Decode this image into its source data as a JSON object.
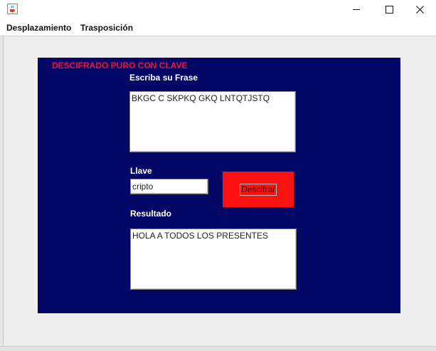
{
  "window": {
    "icon": "java-cup-icon",
    "controls": [
      "minimize-icon",
      "maximize-icon",
      "close-icon"
    ]
  },
  "menu": {
    "items": [
      "Desplazamiento",
      "Trasposición"
    ]
  },
  "panel": {
    "title": "DESCIFRADO PURO CON CLAVE",
    "phrase_label": "Escriba su Frase",
    "phrase_value": "BKGC C SKPKQ GKQ LNTQTJSTQ",
    "key_label": "Llave",
    "key_value": "cripto",
    "decrypt_label": "Descifrar",
    "result_label": "Resultado",
    "result_value": "HOLA A TODOS LOS PRESENTES"
  },
  "colors": {
    "panel_bg": "#050766",
    "title_color": "#e8143c",
    "button_bg": "#ff1010"
  }
}
